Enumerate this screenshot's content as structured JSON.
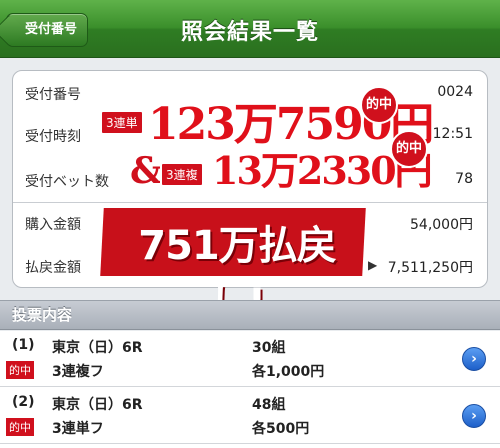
{
  "header": {
    "back_label": "受付番号",
    "title": "照会結果一覧"
  },
  "info": {
    "rows": [
      {
        "label": "受付番号",
        "value": "0024"
      },
      {
        "label": "受付時刻",
        "value": "12:51"
      },
      {
        "label": "受付ベット数",
        "value": "78"
      },
      {
        "label": "購入金額",
        "value": "54,000円"
      },
      {
        "label": "払戻金額",
        "value": "7,511,250円"
      }
    ]
  },
  "promo": {
    "badge1": "3連単",
    "line1": "123万7590円",
    "hit1": "的中",
    "amp": "&",
    "badge2": "3連複",
    "line2": "13万2330円",
    "hit2": "的中",
    "payout": "751万払戻し!"
  },
  "section": {
    "title": "投票内容"
  },
  "bets": [
    {
      "index": "(1)",
      "race": "東京（日）6R",
      "hit": "的中",
      "type": "3連複フ",
      "count": "30組",
      "amount": "各1,000円"
    },
    {
      "index": "(2)",
      "race": "東京（日）6R",
      "hit": "的中",
      "type": "3連単フ",
      "count": "48組",
      "amount": "各500円"
    }
  ],
  "colors": {
    "header_green": "#3b8f2b",
    "accent_red": "#d0101d",
    "chevron_blue": "#1d5fc9"
  }
}
